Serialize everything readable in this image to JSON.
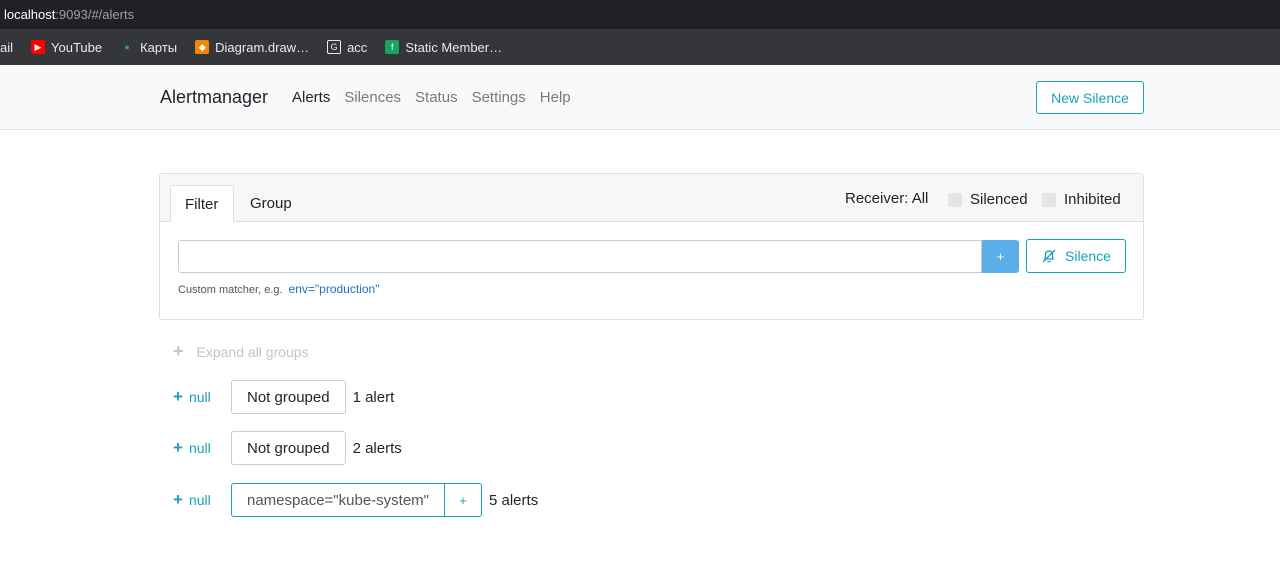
{
  "browser": {
    "url_host": "localhost",
    "url_path": ":9093/#/alerts",
    "bookmarks": [
      {
        "label": "ail",
        "icon": "none"
      },
      {
        "label": "YouTube",
        "icon": "youtube-icon"
      },
      {
        "label": "Карты",
        "icon": "maps-icon"
      },
      {
        "label": "Diagram.draw…",
        "icon": "drawio-icon"
      },
      {
        "label": "acc",
        "icon": "acc-icon"
      },
      {
        "label": "Static Member…",
        "icon": "static-icon"
      }
    ]
  },
  "navbar": {
    "brand": "Alertmanager",
    "links": [
      "Alerts",
      "Silences",
      "Status",
      "Settings",
      "Help"
    ],
    "active": "Alerts",
    "new_silence": "New Silence"
  },
  "filter": {
    "tabs": [
      "Filter",
      "Group"
    ],
    "receiver": "Receiver: All",
    "silenced": "Silenced",
    "inhibited": "Inhibited",
    "input_value": "",
    "plus": "+",
    "silence_button": "Silence",
    "help_text": "Custom matcher, e.g.",
    "help_example": "env=\"production\""
  },
  "groups": {
    "expand_all": "Expand all groups",
    "rows": [
      {
        "receiver": "null",
        "label": "Not grouped",
        "count": "1 alert"
      },
      {
        "receiver": "null",
        "label": "Not grouped",
        "count": "2 alerts"
      },
      {
        "receiver": "null",
        "label": "namespace=\"kube-system\"",
        "count": "5 alerts",
        "plus": "+"
      }
    ]
  },
  "colors": {
    "accent": "#17a2b8",
    "plus_button": "#5aaeea",
    "link": "#1f6fc6"
  }
}
